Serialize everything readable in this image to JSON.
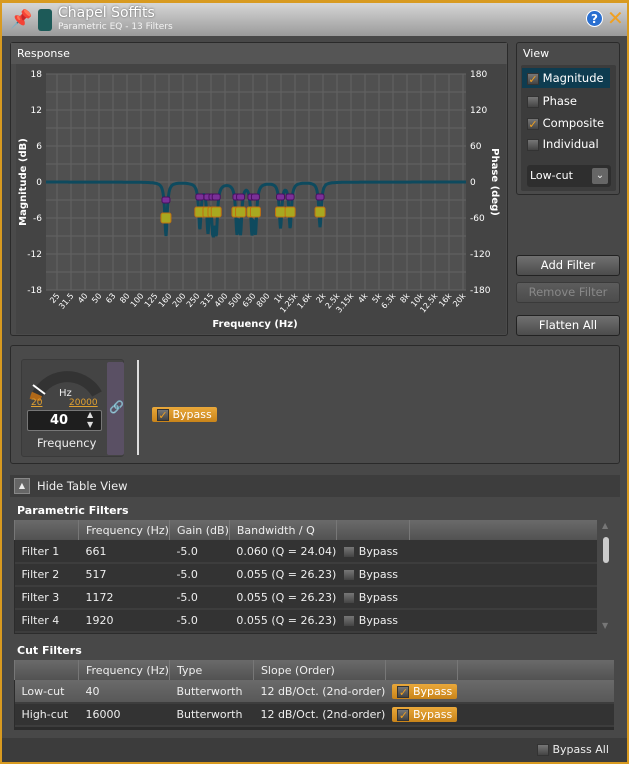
{
  "window": {
    "title": "Chapel Soffits",
    "subtitle": "Parametric EQ - 13 Filters"
  },
  "response": {
    "title": "Response"
  },
  "chart_data": {
    "type": "line",
    "xlabel": "Frequency (Hz)",
    "ylabel": "Magnitude (dB)",
    "y2label": "Phase (deg)",
    "x_scale": "log",
    "x_ticks": [
      "25",
      "31.5",
      "40",
      "50",
      "63",
      "80",
      "100",
      "125",
      "160",
      "200",
      "250",
      "315",
      "400",
      "500",
      "630",
      "800",
      "1k",
      "1.25k",
      "1.6k",
      "2k",
      "2.5k",
      "3.15k",
      "4k",
      "5k",
      "6.3k",
      "8k",
      "10k",
      "12.5k",
      "16k",
      "20k"
    ],
    "xlim": [
      25,
      20000
    ],
    "ylim": [
      -18,
      18
    ],
    "y_ticks": [
      18,
      12,
      6,
      0,
      -6,
      -12,
      -18
    ],
    "y2lim": [
      -180,
      180
    ],
    "y2_ticks": [
      180,
      120,
      60,
      0,
      -60,
      -120,
      -180
    ],
    "grid": true,
    "curve_color": "#0e4a5e",
    "filters": [
      {
        "freq": 151,
        "gain": -6
      },
      {
        "freq": 264,
        "gain": -5
      },
      {
        "freq": 302,
        "gain": -5
      },
      {
        "freq": 328,
        "gain": -5
      },
      {
        "freq": 346,
        "gain": -5
      },
      {
        "freq": 487,
        "gain": -5
      },
      {
        "freq": 517,
        "gain": -5
      },
      {
        "freq": 624,
        "gain": -5
      },
      {
        "freq": 661,
        "gain": -5
      },
      {
        "freq": 1000,
        "gain": -5
      },
      {
        "freq": 1172,
        "gain": -5
      },
      {
        "freq": 1920,
        "gain": -5
      }
    ]
  },
  "view": {
    "title": "View",
    "items": [
      {
        "label": "Magnitude",
        "checked": true
      },
      {
        "label": "Phase",
        "checked": false
      },
      {
        "label": "Composite",
        "checked": true
      },
      {
        "label": "Individual",
        "checked": false
      }
    ],
    "select": "Low-cut"
  },
  "buttons": {
    "add": "Add Filter",
    "remove": "Remove Filter",
    "flatten": "Flatten All"
  },
  "control": {
    "unit": "Hz",
    "min": "20",
    "max": "20000",
    "value": "40",
    "label": "Frequency",
    "bypass": "Bypass"
  },
  "table_toggle": "Hide Table View",
  "parametric": {
    "title": "Parametric Filters",
    "headers": [
      "",
      "Frequency (Hz)",
      "Gain (dB)",
      "Bandwidth / Q",
      "",
      ""
    ],
    "rows": [
      {
        "name": "Filter 1",
        "freq": "661",
        "gain": "-5.0",
        "bw": "0.060 (Q = 24.04)",
        "bypass": "Bypass"
      },
      {
        "name": "Filter 2",
        "freq": "517",
        "gain": "-5.0",
        "bw": "0.055 (Q = 26.23)",
        "bypass": "Bypass"
      },
      {
        "name": "Filter 3",
        "freq": "1172",
        "gain": "-5.0",
        "bw": "0.055 (Q = 26.23)",
        "bypass": "Bypass"
      },
      {
        "name": "Filter 4",
        "freq": "1920",
        "gain": "-5.0",
        "bw": "0.055 (Q = 26.23)",
        "bypass": "Bypass"
      }
    ]
  },
  "cut": {
    "title": "Cut Filters",
    "headers": [
      "",
      "Frequency (Hz)",
      "Type",
      "Slope (Order)",
      "",
      ""
    ],
    "rows": [
      {
        "name": "Low-cut",
        "freq": "40",
        "type": "Butterworth",
        "slope": "12 dB/Oct. (2nd-order)",
        "bypass": "Bypass"
      },
      {
        "name": "High-cut",
        "freq": "16000",
        "type": "Butterworth",
        "slope": "12 dB/Oct. (2nd-order)",
        "bypass": "Bypass"
      }
    ]
  },
  "bypass_all": "Bypass All"
}
